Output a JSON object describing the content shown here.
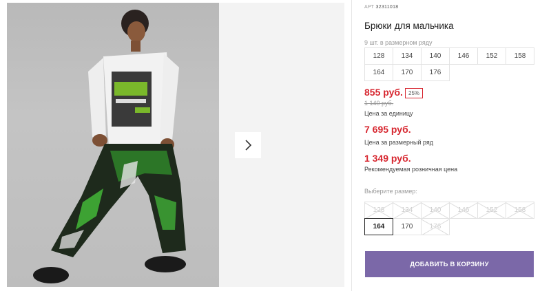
{
  "product": {
    "sku_label": "АРТ",
    "sku_value": "32311018",
    "title": "Брюки для мальчика",
    "pack_note": "9 шт. в размерном ряду",
    "pack_sizes": [
      "128",
      "134",
      "140",
      "146",
      "152",
      "158",
      "164",
      "170",
      "176"
    ]
  },
  "pricing": {
    "unit_price": "855 руб.",
    "discount": "25%",
    "old_price": "1 140 руб.",
    "unit_label": "Цена за единицу",
    "pack_price": "7 695 руб.",
    "pack_label": "Цена за размерный ряд",
    "retail_price": "1 349 руб.",
    "retail_label": "Рекомендуемая розничная цена"
  },
  "size_selector": {
    "label": "Выберите размер:",
    "options": [
      {
        "value": "128",
        "available": false
      },
      {
        "value": "134",
        "available": false
      },
      {
        "value": "140",
        "available": false
      },
      {
        "value": "146",
        "available": false
      },
      {
        "value": "152",
        "available": false
      },
      {
        "value": "158",
        "available": false
      },
      {
        "value": "164",
        "available": true,
        "selected": true
      },
      {
        "value": "170",
        "available": true
      },
      {
        "value": "176",
        "available": false
      }
    ]
  },
  "actions": {
    "add_to_cart": "ДОБАВИТЬ В КОРЗИНУ"
  },
  "icons": {
    "next": "chevron-right-icon"
  },
  "colors": {
    "accent": "#7b68a8",
    "price": "#d7262f"
  }
}
